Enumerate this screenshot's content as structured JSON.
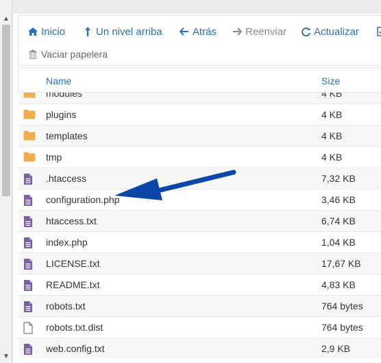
{
  "toolbar": {
    "home_label": "Inicio",
    "up_label": "Un nivel arriba",
    "back_label": "Atrás",
    "forward_label": "Reenviar",
    "refresh_label": "Actualizar",
    "empty_trash_label": "Vaciar papelera"
  },
  "table": {
    "header_name": "Name",
    "header_size": "Size",
    "rows": [
      {
        "name": "modules",
        "size": "4 KB",
        "type": "folder"
      },
      {
        "name": "plugins",
        "size": "4 KB",
        "type": "folder"
      },
      {
        "name": "templates",
        "size": "4 KB",
        "type": "folder"
      },
      {
        "name": "tmp",
        "size": "4 KB",
        "type": "folder"
      },
      {
        "name": ".htaccess",
        "size": "7,32 KB",
        "type": "text-file"
      },
      {
        "name": "configuration.php",
        "size": "3,46 KB",
        "type": "text-file"
      },
      {
        "name": "htaccess.txt",
        "size": "6,74 KB",
        "type": "text-file"
      },
      {
        "name": "index.php",
        "size": "1,04 KB",
        "type": "text-file"
      },
      {
        "name": "LICENSE.txt",
        "size": "17,67 KB",
        "type": "text-file"
      },
      {
        "name": "README.txt",
        "size": "4,83 KB",
        "type": "text-file"
      },
      {
        "name": "robots.txt",
        "size": "764 bytes",
        "type": "text-file"
      },
      {
        "name": "robots.txt.dist",
        "size": "764 bytes",
        "type": "blank-file"
      },
      {
        "name": "web.config.txt",
        "size": "2,9 KB",
        "type": "text-file"
      }
    ]
  },
  "colors": {
    "link": "#2a6fb5",
    "folder": "#f0ad4e",
    "file": "#7b5ea7",
    "arrow": "#0b47a8"
  }
}
